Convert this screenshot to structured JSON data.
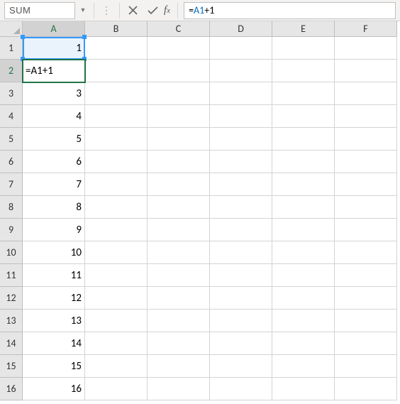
{
  "name_box": "SUM",
  "formula_bar": {
    "prefix": "=",
    "reference": "A1",
    "suffix": "+1"
  },
  "columns": [
    "A",
    "B",
    "C",
    "D",
    "E",
    "F"
  ],
  "rows": [
    1,
    2,
    3,
    4,
    5,
    6,
    7,
    8,
    9,
    10,
    11,
    12,
    13,
    14,
    15,
    16
  ],
  "active": {
    "col": "A",
    "row": 2
  },
  "reference_cell": {
    "col": "A",
    "row": 1
  },
  "editing_display": "=A1+1",
  "cells": {
    "A": {
      "1": "1",
      "2": "=A1+1",
      "3": "3",
      "4": "4",
      "5": "5",
      "6": "6",
      "7": "7",
      "8": "8",
      "9": "9",
      "10": "10",
      "11": "11",
      "12": "12",
      "13": "13",
      "14": "14",
      "15": "15",
      "16": "16"
    }
  }
}
